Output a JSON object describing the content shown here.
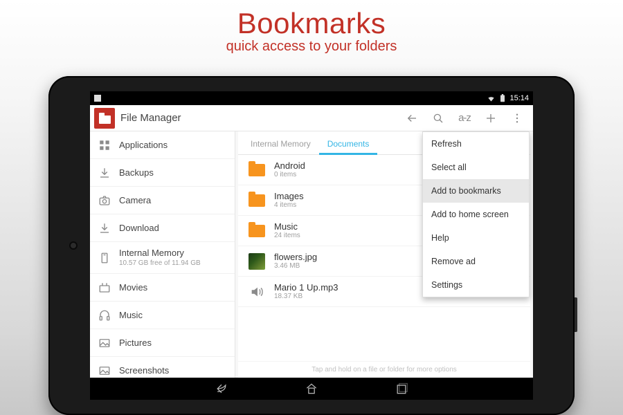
{
  "promo": {
    "title": "Bookmarks",
    "subtitle": "quick access to your folders"
  },
  "status": {
    "time": "15:14"
  },
  "appbar": {
    "title": "File Manager",
    "sort_label": "a-z",
    "actions": {
      "back": "←",
      "search": "search",
      "sort": "a-z",
      "add": "+",
      "overflow": "⋮"
    }
  },
  "sidebar": {
    "items": [
      {
        "icon": "apps",
        "label": "Applications"
      },
      {
        "icon": "download",
        "label": "Backups"
      },
      {
        "icon": "camera",
        "label": "Camera"
      },
      {
        "icon": "download",
        "label": "Download"
      },
      {
        "icon": "storage",
        "label": "Internal Memory",
        "meta": "10.57 GB free of 11.94 GB"
      },
      {
        "icon": "movies",
        "label": "Movies"
      },
      {
        "icon": "music",
        "label": "Music"
      },
      {
        "icon": "pictures",
        "label": "Pictures"
      },
      {
        "icon": "pictures",
        "label": "Screenshots"
      }
    ]
  },
  "tabs": {
    "items": [
      {
        "label": "Internal Memory",
        "active": false
      },
      {
        "label": "Documents",
        "active": true
      }
    ]
  },
  "files": {
    "items": [
      {
        "type": "folder",
        "name": "Android",
        "meta": "0 items"
      },
      {
        "type": "folder",
        "name": "Images",
        "meta": "4 items"
      },
      {
        "type": "folder",
        "name": "Music",
        "meta": "24 items"
      },
      {
        "type": "image",
        "name": "flowers.jpg",
        "meta": "3.46 MB"
      },
      {
        "type": "audio",
        "name": "Mario 1 Up.mp3",
        "meta": "18.37 KB"
      }
    ],
    "hint": "Tap and hold on a file or folder for more options"
  },
  "menu": {
    "items": [
      {
        "label": "Refresh"
      },
      {
        "label": "Select all"
      },
      {
        "label": "Add to bookmarks",
        "highlight": true
      },
      {
        "label": "Add to home screen"
      },
      {
        "label": "Help"
      },
      {
        "label": "Remove ad"
      },
      {
        "label": "Settings"
      }
    ]
  }
}
